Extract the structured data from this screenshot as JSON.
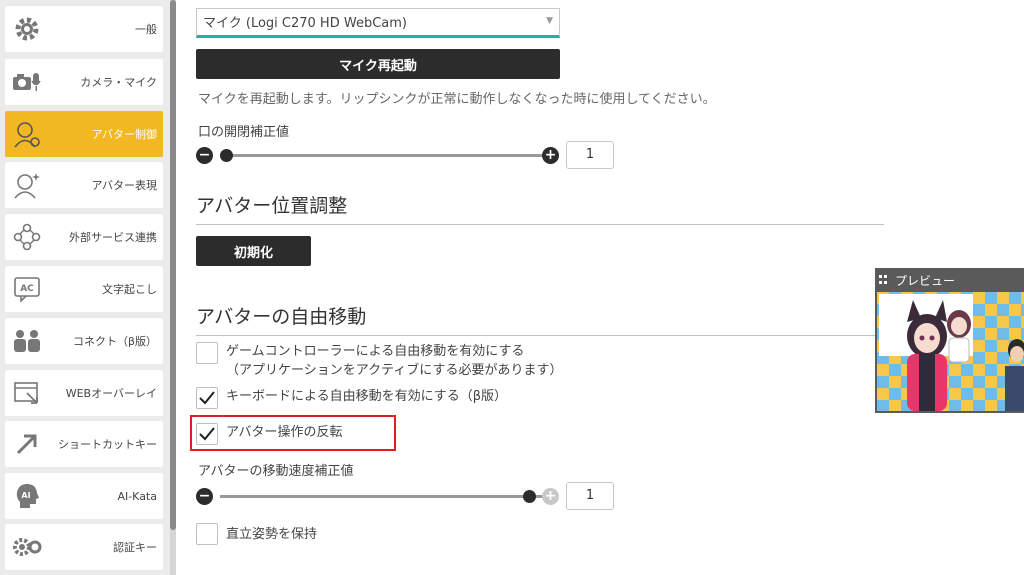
{
  "sidebar": {
    "items": [
      {
        "label": "一般",
        "icon": "gear-icon"
      },
      {
        "label": "カメラ・マイク",
        "icon": "camera-mic-icon"
      },
      {
        "label": "アバター制御",
        "icon": "avatar-control-icon"
      },
      {
        "label": "アバター表現",
        "icon": "avatar-expression-icon"
      },
      {
        "label": "外部サービス連携",
        "icon": "external-service-icon"
      },
      {
        "label": "文字起こし",
        "icon": "transcription-icon"
      },
      {
        "label": "コネクト（β版）",
        "icon": "connect-icon"
      },
      {
        "label": "WEBオーバーレイ",
        "icon": "web-overlay-icon"
      },
      {
        "label": "ショートカットキー",
        "icon": "shortcut-arrow-icon"
      },
      {
        "label": "AI-Kata",
        "icon": "ai-kata-icon"
      },
      {
        "label": "認証キー",
        "icon": "auth-key-icon"
      }
    ],
    "active_index": 2,
    "active_color": "#f2b824"
  },
  "mic": {
    "device_value": "マイク (Logi C270 HD WebCam)",
    "restart_label": "マイク再起動",
    "restart_note": "マイクを再起動します。リップシンクが正常に動作しなくなった時に使用してください。"
  },
  "mouth": {
    "label": "口の開閉補正値",
    "value": "1",
    "slider_fraction": 0.0
  },
  "position": {
    "title": "アバター位置調整",
    "reset_label": "初期化"
  },
  "free_move": {
    "title": "アバターの自由移動",
    "gamepad_label": "ゲームコントローラーによる自由移動を有効にする",
    "gamepad_note": "（アプリケーションをアクティブにする必要があります）",
    "gamepad_checked": false,
    "keyboard_label": "キーボードによる自由移動を有効にする（β版）",
    "keyboard_checked": true,
    "invert_label": "アバター操作の反転",
    "invert_checked": true,
    "speed_label": "アバターの移動速度補正値",
    "speed_value": "1",
    "speed_fraction": 1.0,
    "upright_label": "直立姿勢を保持",
    "upright_checked": false
  },
  "preview": {
    "title": "プレビュー"
  },
  "colors": {
    "accent": "#20b0a8",
    "highlight": "#e02020"
  }
}
